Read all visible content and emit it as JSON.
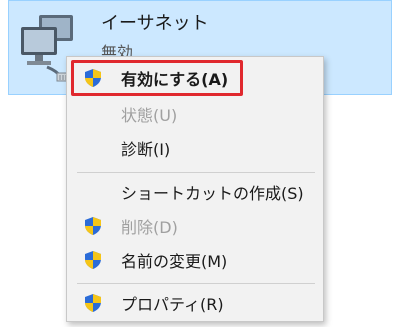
{
  "adapter": {
    "name": "イーサネット",
    "status": "無効"
  },
  "menu": {
    "items": [
      {
        "label": "有効にする(A)",
        "icon": "uac-shield-icon",
        "state": "default"
      },
      {
        "label": "状態(U)",
        "icon": "",
        "state": "disabled"
      },
      {
        "label": "診断(I)",
        "icon": "",
        "state": "normal"
      },
      {
        "label": "ショートカットの作成(S)",
        "icon": "",
        "state": "normal"
      },
      {
        "label": "削除(D)",
        "icon": "uac-shield-icon",
        "state": "disabled"
      },
      {
        "label": "名前の変更(M)",
        "icon": "uac-shield-icon",
        "state": "normal"
      },
      {
        "label": "プロパティ(R)",
        "icon": "uac-shield-icon",
        "state": "normal"
      }
    ]
  },
  "colors": {
    "selection_bg": "#cce8ff",
    "highlight_border": "#e0282e",
    "disabled_text": "#a0a0a0"
  }
}
